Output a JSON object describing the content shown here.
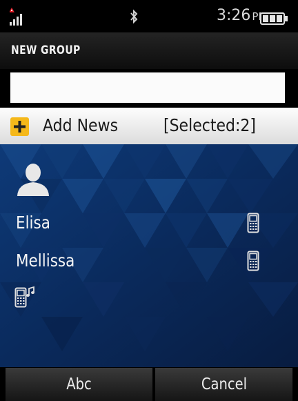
{
  "status_bar": {
    "time": "3:26",
    "ampm": "PM",
    "icons": [
      "signal-icon",
      "bluetooth-icon",
      "battery-icon"
    ]
  },
  "header": {
    "title": "NEW GROUP"
  },
  "group_name_input": {
    "value": "",
    "placeholder": ""
  },
  "add_row": {
    "icon": "plus-icon",
    "label": "Add News",
    "selected_text": "[Selected:2]"
  },
  "members": [
    {
      "name": "Elisa",
      "icon": "mobile-phone-icon"
    },
    {
      "name": "Mellissa",
      "icon": "mobile-phone-icon"
    }
  ],
  "extra_icons": [
    "contact-avatar-icon",
    "ringtone-icon"
  ],
  "softkeys": {
    "left": "Abc",
    "right": "Cancel"
  },
  "colors": {
    "accent_plus": "#f5b81a",
    "background_blue": "#0c2b5c",
    "signal_red": "#e8202a"
  }
}
